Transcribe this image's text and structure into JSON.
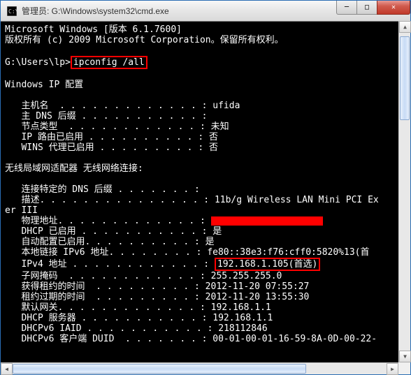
{
  "titlebar": {
    "icon": "cmd-icon",
    "text": "管理员: G:\\Windows\\system32\\cmd.exe"
  },
  "win_buttons": {
    "min": "─",
    "max": "□",
    "close": "✕"
  },
  "console": {
    "line_version": "Microsoft Windows [版本 6.1.7600]",
    "line_copyright": "版权所有 (c) 2009 Microsoft Corporation。保留所有权利。",
    "prompt": "G:\\Users\\lp>",
    "command": "ipconfig /all",
    "heading_ipconfig": "Windows IP 配置",
    "hostname_label": "   主机名  . . . . . . . . . . . . . : ",
    "hostname_value": "ufida",
    "dns_suffix": "   主 DNS 后缀 . . . . . . . . . . . :",
    "node_type_label": "   节点类型  . . . . . . . . . . . . : ",
    "node_type_value": "未知",
    "ip_routing_label": "   IP 路由已启用 . . . . . . . . . . : ",
    "ip_routing_value": "否",
    "wins_proxy_label": "   WINS 代理已启用 . . . . . . . . . : ",
    "wins_proxy_value": "否",
    "adapter_heading": "无线局域网适配器 无线网络连接:",
    "conn_dns_suffix": "   连接特定的 DNS 后缀 . . . . . . . :",
    "description_label": "   描述. . . . . . . . . . . . . . . : ",
    "description_value": "11b/g Wireless LAN Mini PCI Ex",
    "description_cont": "er III",
    "phys_addr_label": "   物理地址. . . . . . . . . . . . . : ",
    "dhcp_enabled_label": "   DHCP 已启用 . . . . . . . . . . . : ",
    "dhcp_enabled_value": "是",
    "autoconf_label": "   自动配置已启用. . . . . . . . . . : ",
    "autoconf_value": "是",
    "link_local_label": "   本地链接 IPv6 地址. . . . . . . . : ",
    "link_local_value": "fe80::38e3:f76:cff0:5820%13(首",
    "ipv4_label": "   IPv4 地址 . . . . . . . . . . . . : ",
    "ipv4_value": "192.168.1.105(首选)",
    "subnet_label": "   子网掩码  . . . . . . . . . . . . : ",
    "subnet_value": "255.255.255.0",
    "lease_obtained_label": "   获得租约的时间  . . . . . . . . . : ",
    "lease_obtained_value": "2012-11-20 07:55:27",
    "lease_expires_label": "   租约过期的时间  . . . . . . . . . : ",
    "lease_expires_value": "2012-11-20 13:55:30",
    "gateway_label": "   默认网关. . . . . . . . . . . . . : ",
    "gateway_value": "192.168.1.1",
    "dhcp_server_label": "   DHCP 服务器 . . . . . . . . . . . : ",
    "dhcp_server_value": "192.168.1.1",
    "dhcpv6_iaid_label": "   DHCPv6 IAID . . . . . . . . . . . : ",
    "dhcpv6_iaid_value": "218112846",
    "dhcpv6_duid_label": "   DHCPv6 客户端 DUID  . . . . . . . : ",
    "dhcpv6_duid_value": "00-01-00-01-16-59-8A-0D-00-22-"
  },
  "scrollbar": {
    "up": "▲",
    "down": "▼",
    "left": "◀",
    "right": "▶"
  }
}
